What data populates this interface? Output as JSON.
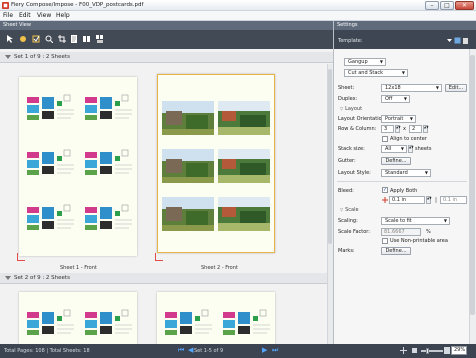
{
  "window": {
    "title": "Fiery Compose/Impose - F00_VDP_postcards.pdf",
    "controls": {
      "minimize": "–",
      "maximize": "□",
      "close": "✕"
    }
  },
  "menu": {
    "items": [
      "File",
      "Edit",
      "View",
      "Help"
    ]
  },
  "sheet_view": {
    "header": "Sheet View",
    "sets": [
      {
        "label": "Set 1 of 9 : 2 Sheets"
      },
      {
        "label": "Set 2 of 9 : 2 Sheets"
      }
    ],
    "sheets": [
      {
        "label": "Sheet 1 - Front"
      },
      {
        "label": "Sheet 2 - Front"
      }
    ]
  },
  "settings": {
    "header": "Settings",
    "template_label": "Template:",
    "workflow": "Gangup",
    "mode": "Cut and Stack",
    "sheet_label": "Sheet:",
    "sheet_value": "12x18",
    "edit_button": "Edit...",
    "duplex_label": "Duplex:",
    "duplex_value": "Off",
    "layout_section": "Layout",
    "orientation_label": "Layout Orientation:",
    "orientation_value": "Portrait",
    "rowcol_label": "Row & Column:",
    "rows": "3",
    "cols": "2",
    "times": "x",
    "align_center": "Align to center",
    "stack_label": "Stack size:",
    "stack_value": "All",
    "stack_unit": "sheets",
    "gutter_label": "Gutter:",
    "define_button": "Define...",
    "layout_style_label": "Layout Style:",
    "layout_style_value": "Standard",
    "bleed_label": "Bleed:",
    "apply_both": "Apply Both",
    "bleed_value_1": "0.1 in",
    "bleed_value_2": "0.1 in",
    "scale_section": "Scale",
    "scaling_label": "Scaling:",
    "scaling_value": "Scale to fit",
    "scale_factor_label": "Scale Factor:",
    "scale_factor_value": "81.6667",
    "percent": "%",
    "non_printable": "Use Non-printable area",
    "marks_label": "Marks:",
    "marks_button": "Define..."
  },
  "status": {
    "left": "Total Pages: 108 | Total Sheets: 18",
    "pager": "Set 1-5 of 9",
    "zoom": "29%"
  },
  "colors": {
    "toolbar": "#424a55",
    "header": "#5f6b7a",
    "accent": "#55a6ff",
    "sheet_bg": "#fdfef2",
    "selection": "#e8b34a"
  }
}
